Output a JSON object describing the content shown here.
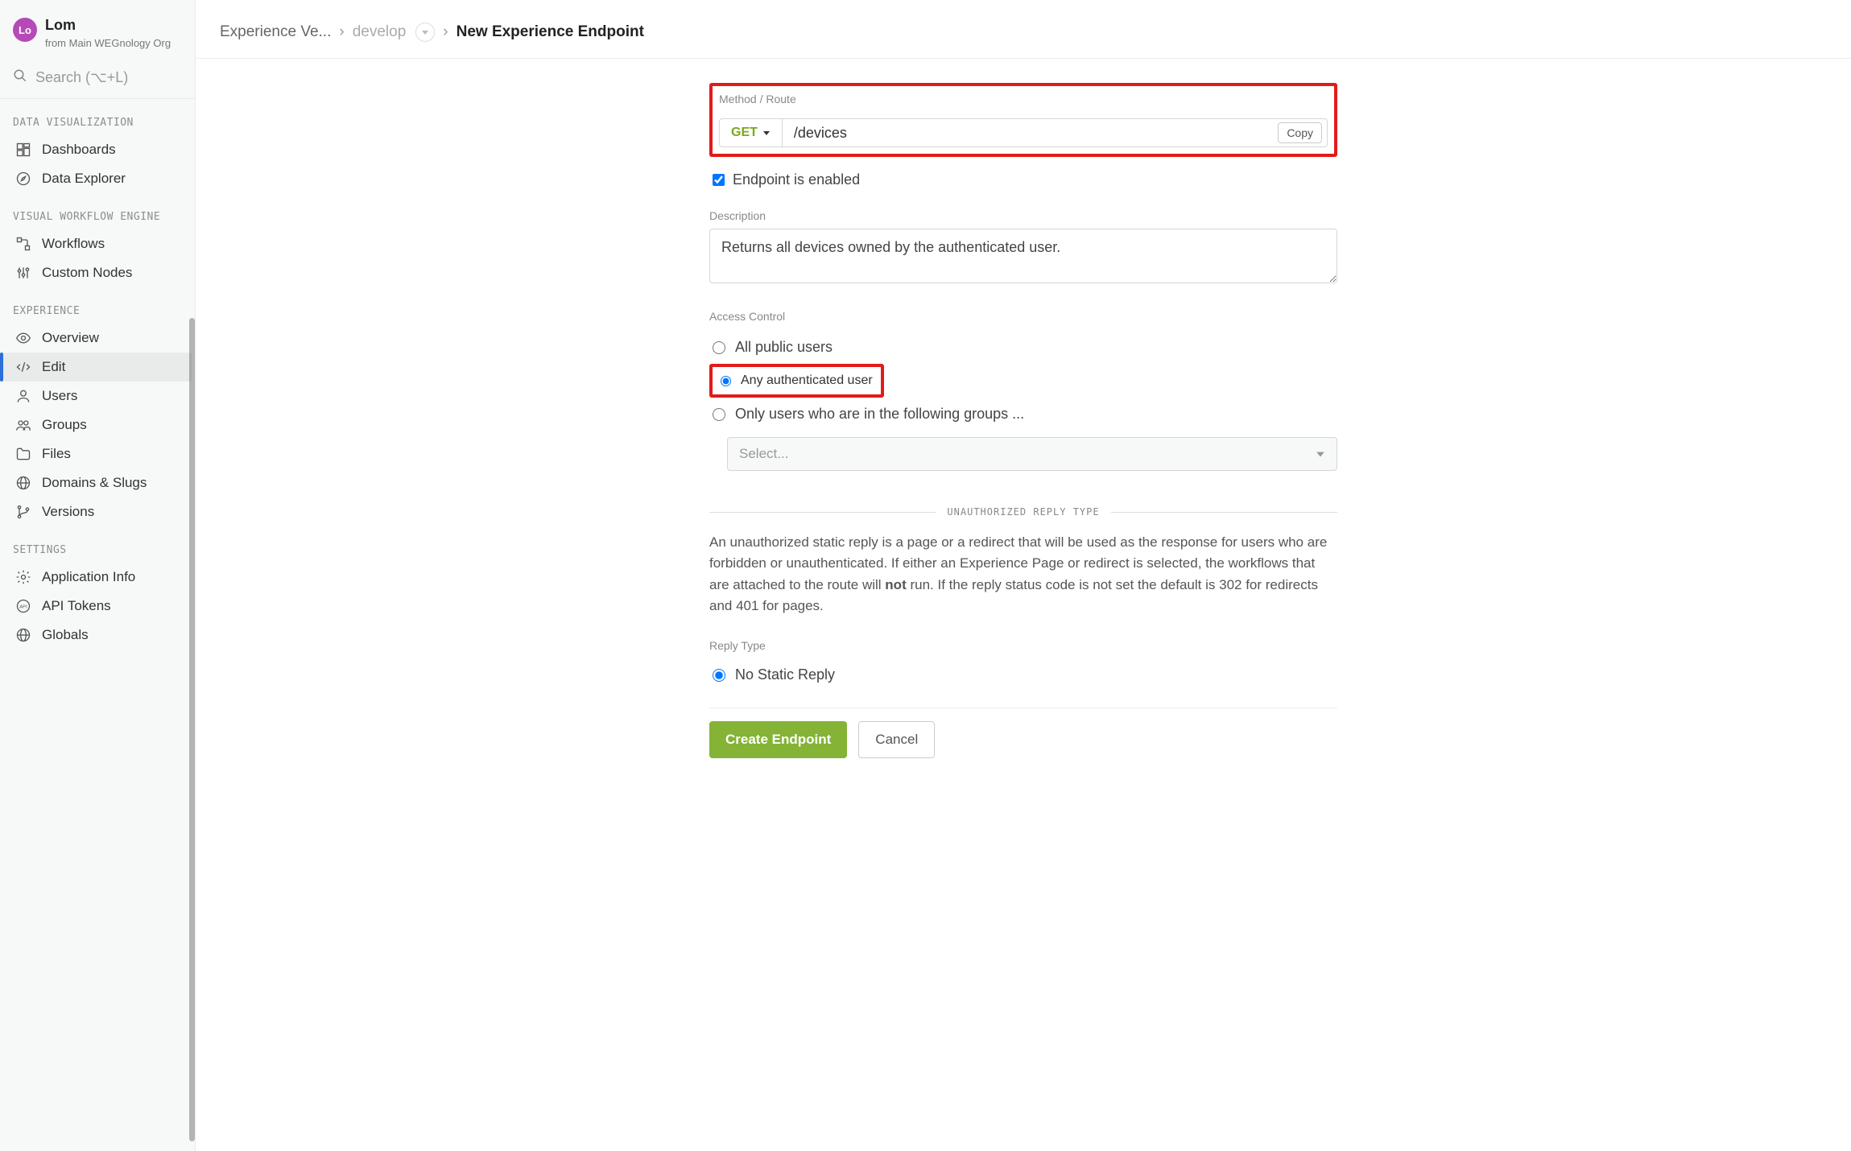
{
  "user": {
    "initials": "Lo",
    "name": "Lom",
    "org_prefix": "from ",
    "org": "Main WEGnology Org"
  },
  "search": {
    "placeholder": "Search (⌥+L)"
  },
  "sidebar": {
    "sections": [
      {
        "label": "DATA VISUALIZATION",
        "items": [
          "Dashboards",
          "Data Explorer"
        ]
      },
      {
        "label": "VISUAL WORKFLOW ENGINE",
        "items": [
          "Workflows",
          "Custom Nodes"
        ]
      },
      {
        "label": "EXPERIENCE",
        "items": [
          "Overview",
          "Edit",
          "Users",
          "Groups",
          "Files",
          "Domains & Slugs",
          "Versions"
        ]
      },
      {
        "label": "SETTINGS",
        "items": [
          "Application Info",
          "API Tokens",
          "Globals"
        ]
      }
    ]
  },
  "breadcrumb": {
    "first": "Experience Ve...",
    "branch": "develop",
    "current": "New Experience Endpoint"
  },
  "form": {
    "method_route_label": "Method / Route",
    "method": "GET",
    "route": "/devices",
    "copy": "Copy",
    "enabled_label": "Endpoint is enabled",
    "enabled": true,
    "description_label": "Description",
    "description": "Returns all devices owned by the authenticated user.",
    "access_label": "Access Control",
    "access_options": [
      "All public users",
      "Any authenticated user",
      "Only users who are in the following groups ..."
    ],
    "access_selected_index": 1,
    "group_select_placeholder": "Select...",
    "unauthorized_heading": "UNAUTHORIZED REPLY TYPE",
    "unauthorized_help_pre": "An unauthorized static reply is a page or a redirect that will be used as the response for users who are forbidden or unauthenticated. If either an Experience Page or redirect is selected, the workflows that are attached to the route will ",
    "unauthorized_help_bold": "not",
    "unauthorized_help_post": " run. If the reply status code is not set the default is 302 for redirects and 401 for pages.",
    "reply_type_label": "Reply Type",
    "reply_options": [
      "No Static Reply"
    ],
    "reply_selected_index": 0,
    "submit": "Create Endpoint",
    "cancel": "Cancel"
  }
}
